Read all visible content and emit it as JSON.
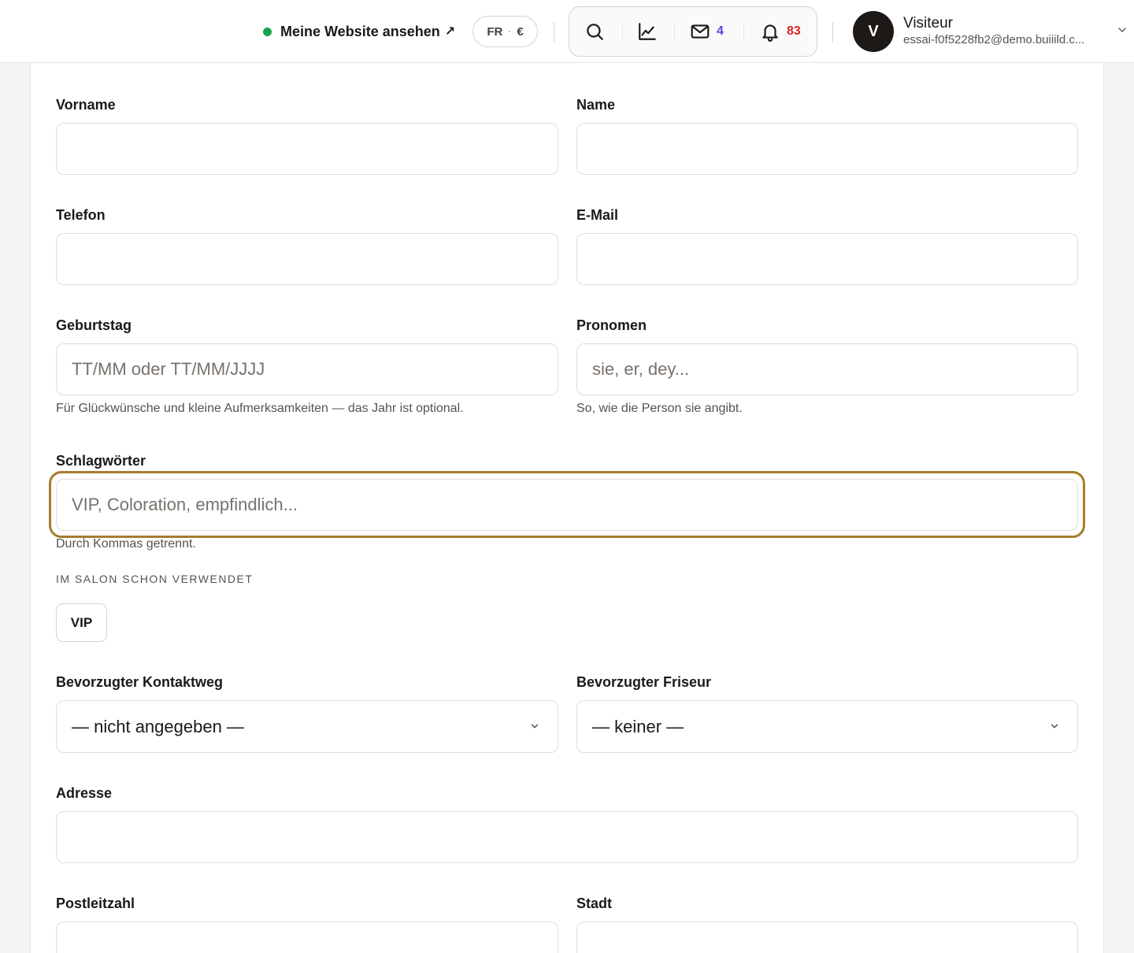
{
  "header": {
    "site_link": "Meine Website ansehen",
    "site_link_arrow": "↗",
    "status_color": "#16a34a",
    "language": "FR",
    "currency": "€",
    "mail_count": "4",
    "notification_count": "83",
    "icons": [
      "search-icon",
      "analytics-icon",
      "mail-icon",
      "bell-icon"
    ]
  },
  "user": {
    "initial": "V",
    "name": "Visiteur",
    "email": "essai-f0f5228fb2@demo.buiiild.c..."
  },
  "form": {
    "vorname": {
      "label": "Vorname",
      "value": ""
    },
    "name": {
      "label": "Name",
      "value": ""
    },
    "telefon": {
      "label": "Telefon",
      "value": ""
    },
    "email": {
      "label": "E-Mail",
      "value": ""
    },
    "geburtstag": {
      "label": "Geburtstag",
      "placeholder": "TT/MM oder TT/MM/JJJJ",
      "help": "Für Glückwünsche und kleine Aufmerksamkeiten — das Jahr ist optional."
    },
    "pronomen": {
      "label": "Pronomen",
      "placeholder": "sie, er, dey...",
      "help": "So, wie die Person sie angibt."
    },
    "schlagwoerter": {
      "label": "Schlagwörter",
      "placeholder": "VIP, Coloration, empfindlich...",
      "help": "Durch Kommas getrennt.",
      "focus_color": "#a67c2e"
    },
    "used_tags": {
      "caption": "IM SALON SCHON VERWENDET",
      "tags": [
        "VIP"
      ]
    },
    "kontaktweg": {
      "label": "Bevorzugter Kontaktweg",
      "selected": "— nicht angegeben —"
    },
    "friseur": {
      "label": "Bevorzugter Friseur",
      "selected": "— keiner —"
    },
    "adresse": {
      "label": "Adresse",
      "value": ""
    },
    "postleitzahl": {
      "label": "Postleitzahl",
      "value": ""
    },
    "stadt": {
      "label": "Stadt",
      "value": ""
    }
  }
}
